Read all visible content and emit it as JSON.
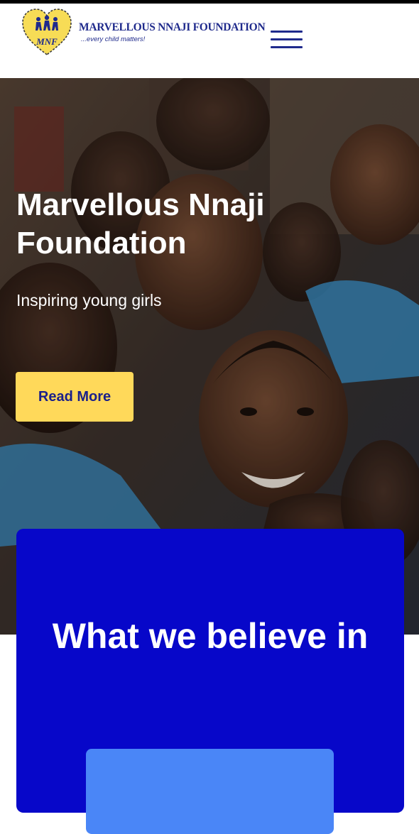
{
  "header": {
    "brand_name": "MARVELLOUS NNAJI FOUNDATION",
    "tagline": "...every child matters!",
    "logo_letters": "MNF",
    "menu_icon": "hamburger-menu-icon"
  },
  "hero": {
    "title": "Marvellous Nnaji Foundation",
    "subtitle": "Inspiring young girls",
    "cta_label": "Read More"
  },
  "beliefs": {
    "title": "What we believe in"
  },
  "colors": {
    "brand_navy": "#1f2a8c",
    "brand_blue": "#0707c9",
    "card_blue": "#4a86f7",
    "accent_yellow": "#ffd95a",
    "cta_text": "#1a1f8a",
    "logo_yellow": "#f7dc56",
    "topbar": "#000000"
  }
}
